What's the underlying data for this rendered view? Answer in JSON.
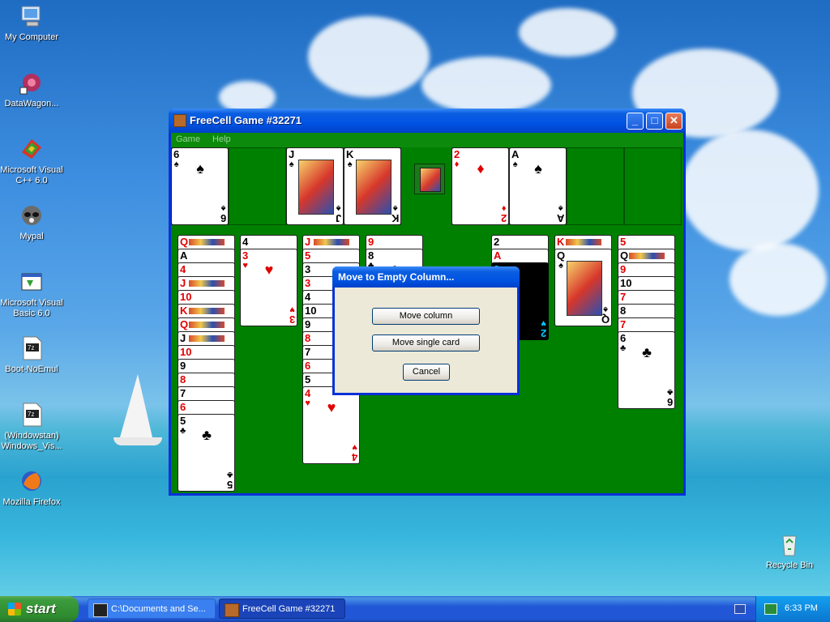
{
  "desktop": {
    "icons": [
      {
        "label": "My Computer"
      },
      {
        "label": "DataWagon..."
      },
      {
        "label": "Microsoft Visual C++ 6.0"
      },
      {
        "label": "Mypal"
      },
      {
        "label": "Microsoft Visual Basic 6.0"
      },
      {
        "label": "Boot-NoEmul"
      },
      {
        "label": "(Windowstan) Windows_Vis..."
      },
      {
        "label": "Mozilla Firefox"
      },
      {
        "label": "Recycle Bin"
      }
    ]
  },
  "window": {
    "title": "FreeCell Game #32271",
    "menu": [
      "Game",
      "Help"
    ],
    "controls": {
      "minimize": "_",
      "maximize": "□",
      "close": "✕"
    }
  },
  "game": {
    "free_cells": [
      {
        "rank": "6",
        "suit": "♠",
        "color": "black"
      },
      {
        "rank": "",
        "suit": "",
        "color": ""
      },
      {
        "rank": "J",
        "suit": "♠",
        "color": "black"
      },
      {
        "rank": "K",
        "suit": "♠",
        "color": "black"
      }
    ],
    "foundations": [
      {
        "rank": "2",
        "suit": "♦",
        "color": "red"
      },
      {
        "rank": "A",
        "suit": "♠",
        "color": "black"
      },
      {
        "rank": "",
        "suit": "",
        "color": ""
      },
      {
        "rank": "",
        "suit": "",
        "color": ""
      }
    ],
    "columns": [
      [
        {
          "rank": "Q",
          "suit": "♥",
          "color": "red"
        },
        {
          "rank": "A",
          "suit": "♠",
          "color": "black"
        },
        {
          "rank": "4",
          "suit": "♥",
          "color": "red"
        },
        {
          "rank": "J",
          "suit": "♥",
          "color": "red"
        },
        {
          "rank": "10",
          "suit": "♥",
          "color": "red"
        },
        {
          "rank": "K",
          "suit": "♥",
          "color": "red"
        },
        {
          "rank": "Q",
          "suit": "♥",
          "color": "red"
        },
        {
          "rank": "J",
          "suit": "♠",
          "color": "black"
        },
        {
          "rank": "10",
          "suit": "♥",
          "color": "red"
        },
        {
          "rank": "9",
          "suit": "♠",
          "color": "black"
        },
        {
          "rank": "8",
          "suit": "♥",
          "color": "red"
        },
        {
          "rank": "7",
          "suit": "♠",
          "color": "black"
        },
        {
          "rank": "6",
          "suit": "♥",
          "color": "red"
        },
        {
          "rank": "5",
          "suit": "♣",
          "color": "black"
        }
      ],
      [
        {
          "rank": "4",
          "suit": "♠",
          "color": "black"
        },
        {
          "rank": "3",
          "suit": "♥",
          "color": "red"
        }
      ],
      [
        {
          "rank": "J",
          "suit": "♥",
          "color": "red"
        },
        {
          "rank": "5",
          "suit": "♥",
          "color": "red"
        },
        {
          "rank": "3",
          "suit": "♠",
          "color": "black"
        },
        {
          "rank": "3",
          "suit": "♥",
          "color": "red"
        },
        {
          "rank": "4",
          "suit": "♠",
          "color": "black"
        },
        {
          "rank": "10",
          "suit": "♠",
          "color": "black"
        },
        {
          "rank": "9",
          "suit": "♠",
          "color": "black"
        },
        {
          "rank": "8",
          "suit": "♥",
          "color": "red"
        },
        {
          "rank": "7",
          "suit": "♠",
          "color": "black"
        },
        {
          "rank": "6",
          "suit": "♥",
          "color": "red"
        },
        {
          "rank": "5",
          "suit": "♠",
          "color": "black"
        },
        {
          "rank": "4",
          "suit": "♥",
          "color": "red"
        }
      ],
      [
        {
          "rank": "9",
          "suit": "♥",
          "color": "red"
        },
        {
          "rank": "8",
          "suit": "♣",
          "color": "black"
        }
      ],
      [],
      [
        {
          "rank": "2",
          "suit": "♠",
          "color": "black"
        },
        {
          "rank": "A",
          "suit": "♥",
          "color": "red"
        },
        {
          "rank": "2",
          "suit": "♥",
          "color": "cyan"
        }
      ],
      [
        {
          "rank": "K",
          "suit": "♥",
          "color": "red"
        },
        {
          "rank": "Q",
          "suit": "♠",
          "color": "black"
        }
      ],
      [
        {
          "rank": "5",
          "suit": "♥",
          "color": "red"
        },
        {
          "rank": "Q",
          "suit": "♣",
          "color": "black"
        },
        {
          "rank": "9",
          "suit": "♥",
          "color": "red"
        },
        {
          "rank": "10",
          "suit": "♠",
          "color": "black"
        },
        {
          "rank": "7",
          "suit": "♥",
          "color": "red"
        },
        {
          "rank": "8",
          "suit": "♠",
          "color": "black"
        },
        {
          "rank": "7",
          "suit": "♥",
          "color": "red"
        },
        {
          "rank": "6",
          "suit": "♣",
          "color": "black"
        }
      ]
    ]
  },
  "dialog": {
    "title": "Move to Empty Column...",
    "buttons": {
      "move_column": "Move column",
      "move_single": "Move single card",
      "cancel": "Cancel"
    }
  },
  "taskbar": {
    "start_label": "start",
    "items": [
      {
        "label": "C:\\Documents and Se..."
      },
      {
        "label": "FreeCell Game #32271"
      }
    ],
    "clock": "6:33 PM"
  },
  "colors": {
    "felt": "#008000",
    "title_blue": "#0054e3",
    "taskbar_blue": "#2157d7",
    "start_green": "#3c9c3c",
    "dialog_face": "#ece9d8"
  }
}
